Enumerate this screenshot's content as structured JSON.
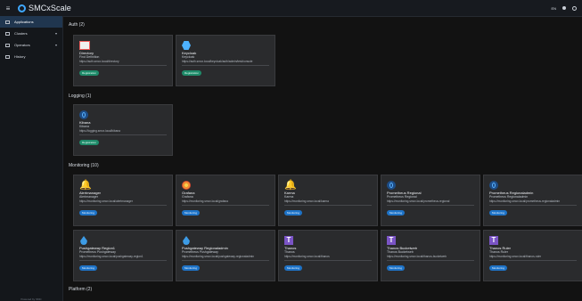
{
  "header": {
    "brand": "SMCxScale",
    "right_label": "EN"
  },
  "sidebar": {
    "items": [
      {
        "label": "Applications",
        "icon": "grid-icon",
        "active": true
      },
      {
        "label": "Clusters",
        "icon": "cluster-icon",
        "arrow": "▾"
      },
      {
        "label": "Operators",
        "icon": "operators-icon",
        "arrow": "▾"
      },
      {
        "label": "History",
        "icon": "history-icon"
      }
    ],
    "footer": "Powered by SMC"
  },
  "sections": [
    {
      "title": "Auth (2)",
      "cards": [
        {
          "title": "Directory",
          "subtitle": "Find Definition",
          "url": "https://auth.smcx.local/directory",
          "tag": "Registration",
          "icon": "directory-icon"
        },
        {
          "title": "Keycloak",
          "subtitle": "Keycloak",
          "url": "https://auth.smcx.local/keycloak/auth/admin/test/console",
          "tag": "Registration",
          "icon": "keycloak-icon"
        }
      ]
    },
    {
      "title": "Logging (1)",
      "cards": [
        {
          "title": "Kibana",
          "subtitle": "Kibana",
          "url": "https://logging.smcx.local/kibana",
          "tag": "Registration",
          "icon": "kibana-icon"
        }
      ]
    },
    {
      "title": "Monitoring (10)",
      "cards": [
        {
          "title": "Alertmanager",
          "subtitle": "Alertmanager",
          "url": "https://monitoring.smcx.local/alertmanager",
          "tag": "Monitoring",
          "icon": "bell-icon"
        },
        {
          "title": "Grafana",
          "subtitle": "Grafana",
          "url": "https://monitoring.smcx.local/grafana",
          "tag": "Monitoring",
          "icon": "grafana-icon"
        },
        {
          "title": "Karma",
          "subtitle": "Karma",
          "url": "https://monitoring.smcx.local/karma",
          "tag": "Monitoring",
          "icon": "bell-icon"
        },
        {
          "title": "Prometheus Regional",
          "subtitle": "Prometheus Regional",
          "url": "https://monitoring.smcx.local/prometheus-regional",
          "tag": "Monitoring",
          "icon": "prometheus-icon"
        },
        {
          "title": "Prometheus Regionaladmin",
          "subtitle": "Prometheus Regionaladmin",
          "url": "https://monitoring.smcx.local/prometheus-regionaladmin",
          "tag": "Monitoring",
          "icon": "prometheus-icon"
        },
        {
          "title": "Pushgateway Region1",
          "subtitle": "Prometheus Pushgateway",
          "url": "https://monitoring.smcx.local/pushgateway-region1",
          "tag": "Monitoring",
          "icon": "drop-icon"
        },
        {
          "title": "Pushgateway Regionaladmin",
          "subtitle": "Prometheus Pushgateway",
          "url": "https://monitoring.smcx.local/pushgateway-regionaladmin",
          "tag": "Monitoring",
          "icon": "drop-icon"
        },
        {
          "title": "Thanos",
          "subtitle": "Thanos",
          "url": "https://monitoring.smcx.local/thanos",
          "tag": "Monitoring",
          "icon": "thanos-icon"
        },
        {
          "title": "Thanos Bucketweb",
          "subtitle": "Thanos Bucketweb",
          "url": "https://monitoring.smcx.local/thanos-bucketweb",
          "tag": "Monitoring",
          "icon": "thanos-icon"
        },
        {
          "title": "Thanos Ruler",
          "subtitle": "Thanos Ruler",
          "url": "https://monitoring.smcx.local/thanos-ruler",
          "tag": "Monitoring",
          "icon": "thanos-icon"
        }
      ]
    },
    {
      "title": "Platform (2)",
      "cards": []
    }
  ]
}
